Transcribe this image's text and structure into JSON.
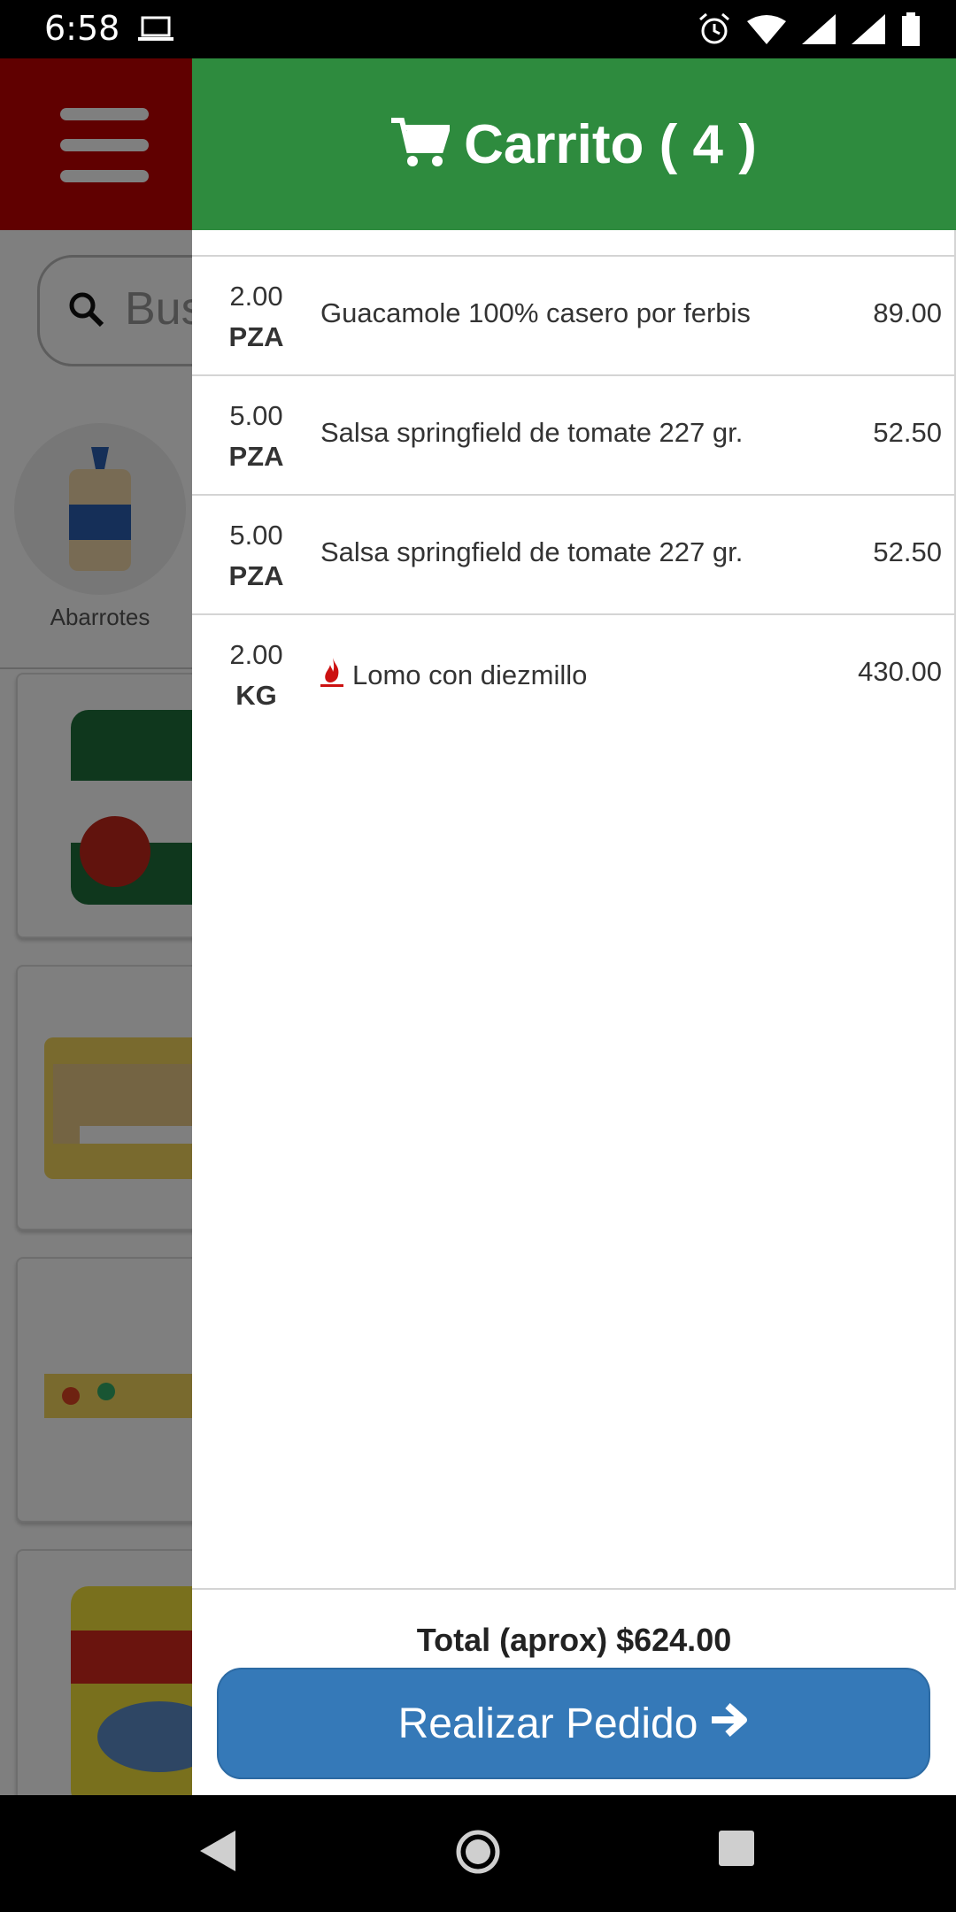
{
  "status_bar": {
    "time": "6:58"
  },
  "background": {
    "search_placeholder": "Bus",
    "category_label": "Abarrotes"
  },
  "cart": {
    "title": "Carrito ( 4 )",
    "items": [
      {
        "qty": "2.00",
        "unit": "PZA",
        "name": "Guacamole 100% casero por ferbis",
        "price": "89.00",
        "icon": ""
      },
      {
        "qty": "5.00",
        "unit": "PZA",
        "name": "Salsa springfield de tomate 227 gr.",
        "price": "52.50",
        "icon": ""
      },
      {
        "qty": "5.00",
        "unit": "PZA",
        "name": "Salsa springfield de tomate 227 gr.",
        "price": "52.50",
        "icon": ""
      },
      {
        "qty": "2.00",
        "unit": "KG",
        "name": "Lomo con diezmillo",
        "price": "430.00",
        "icon": "fire-icon"
      }
    ],
    "total": "Total (aprox) $624.00",
    "order_button": "Realizar Pedido"
  },
  "colors": {
    "header_green": "#2e8b3e",
    "app_red": "#c00000",
    "button_blue": "#3579b8",
    "fire_red": "#cc1111"
  }
}
